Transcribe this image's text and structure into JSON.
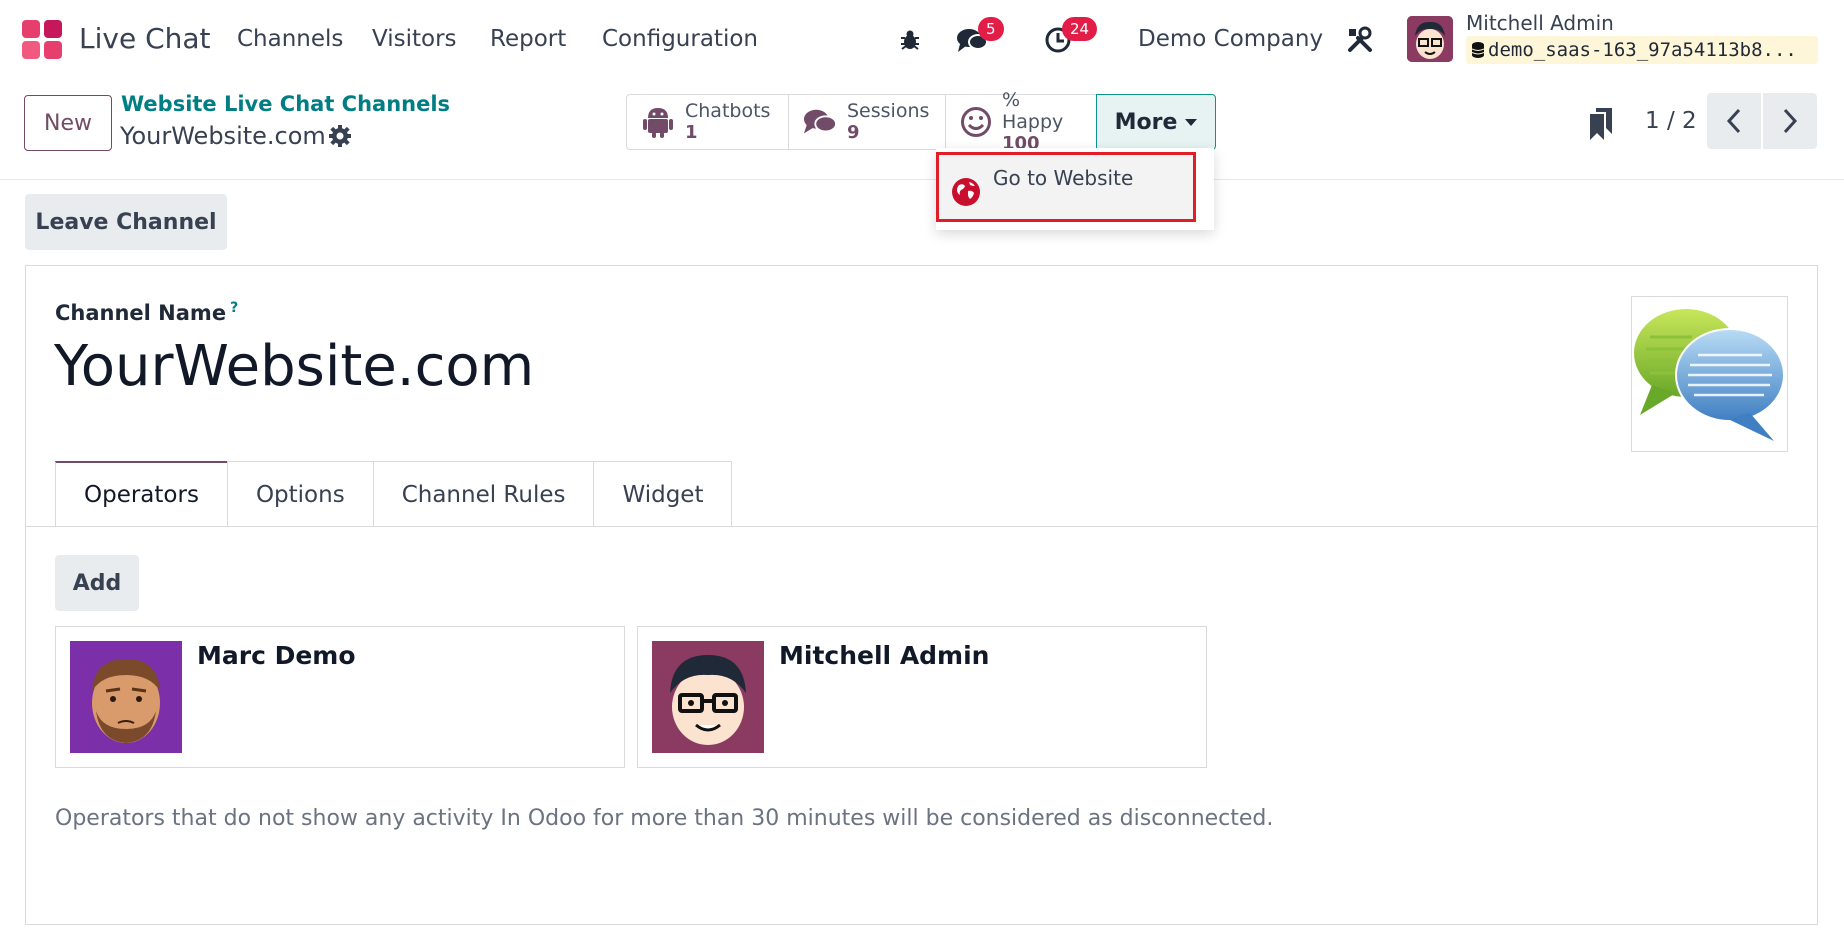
{
  "navbar": {
    "app_name": "Live Chat",
    "menu": [
      "Channels",
      "Visitors",
      "Report",
      "Configuration"
    ],
    "messages_count": "5",
    "activities_count": "24",
    "company": "Demo Company",
    "user_name": "Mitchell Admin",
    "database": "demo_saas-163_97a54113b8..."
  },
  "control": {
    "new_label": "New",
    "breadcrumb": "Website Live Chat Channels",
    "record_name": "YourWebsite.com",
    "stats": [
      {
        "label": "Chatbots",
        "value": "1",
        "icon": "android-icon"
      },
      {
        "label": "Sessions",
        "value": "9",
        "icon": "comments-icon"
      },
      {
        "label": "% Happy",
        "value": "100",
        "icon": "smile-icon"
      }
    ],
    "more_label": "More",
    "pager": "1 / 2"
  },
  "dropdown": {
    "item_label": "Go to Website"
  },
  "actions": {
    "leave_label": "Leave Channel"
  },
  "form": {
    "name_label": "Channel Name",
    "name_help": "?",
    "name_value": "YourWebsite.com",
    "tabs": [
      "Operators",
      "Options",
      "Channel Rules",
      "Widget"
    ],
    "add_label": "Add",
    "operators": [
      {
        "name": "Marc Demo"
      },
      {
        "name": "Mitchell Admin"
      }
    ],
    "help_text": "Operators that do not show any activity In Odoo for more than 30 minutes will be considered as disconnected."
  },
  "colors": {
    "brand": "#714b67",
    "teal": "#017e84",
    "badge": "#e11d48",
    "highlight": "#e11d28"
  }
}
